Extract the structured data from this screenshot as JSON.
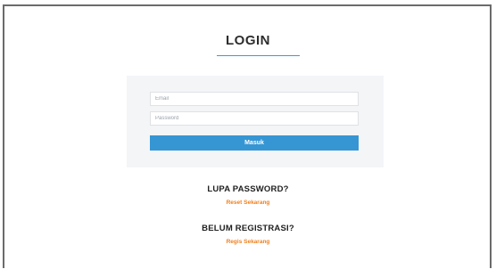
{
  "login_form": {
    "title": "LOGIN",
    "email_placeholder": "Email",
    "password_placeholder": "Password",
    "submit_label": "Masuk"
  },
  "forgot_password": {
    "heading": "LUPA PASSWORD?",
    "link_label": "Reset Sekarang"
  },
  "register": {
    "heading": "BELUM REGISTRASI?",
    "link_label": "Regis Sekarang"
  },
  "colors": {
    "accent_blue": "#3696d3",
    "link_orange": "#f07f1c",
    "panel_background": "#f4f5f7"
  }
}
